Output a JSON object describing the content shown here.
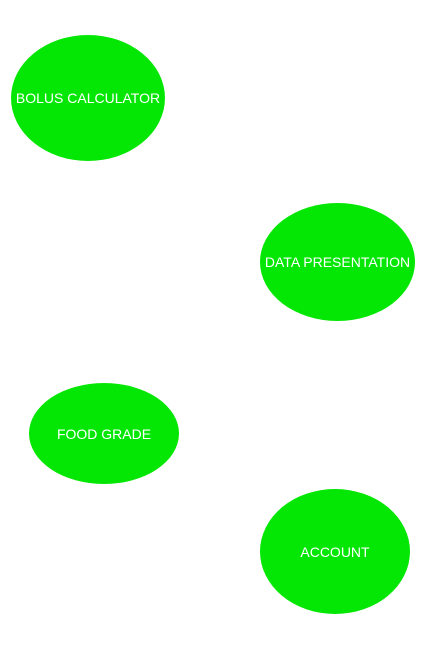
{
  "menu": {
    "bolus_calculator": "BOLUS CALCULATOR",
    "data_presentation": "DATA PRESENTATION",
    "food_grade": "FOOD GRADE",
    "account": "ACCOUNT"
  },
  "colors": {
    "button_fill": "#04e704",
    "button_text": "#ffffff",
    "background": "#ffffff"
  }
}
